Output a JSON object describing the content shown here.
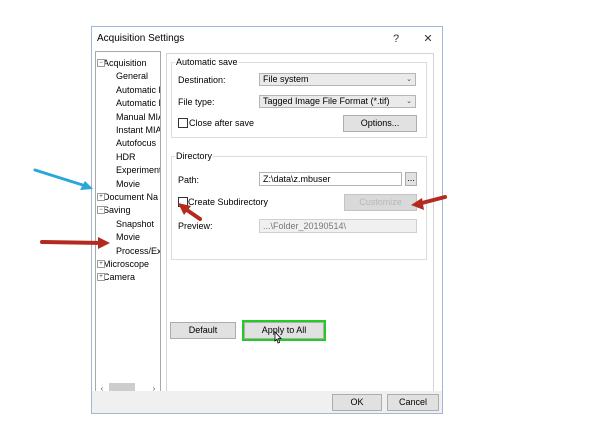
{
  "window": {
    "title": "Acquisition Settings",
    "help_glyph": "?",
    "close_glyph": "✕"
  },
  "tree": {
    "items": [
      {
        "label": "Acquisition",
        "toggle": "−"
      },
      {
        "label": "General"
      },
      {
        "label": "Automatic E"
      },
      {
        "label": "Automatic M"
      },
      {
        "label": "Manual MIA"
      },
      {
        "label": "Instant MIA"
      },
      {
        "label": "Autofocus"
      },
      {
        "label": "HDR"
      },
      {
        "label": "Experiment"
      },
      {
        "label": "Movie"
      },
      {
        "label": "Document Na",
        "toggle": "+"
      },
      {
        "label": "Saving",
        "toggle": "−"
      },
      {
        "label": "Snapshot"
      },
      {
        "label": "Movie"
      },
      {
        "label": "Process/Exp"
      },
      {
        "label": "Microscope",
        "toggle": "+"
      },
      {
        "label": "Camera",
        "toggle": "+"
      }
    ],
    "scroll_left": "‹",
    "scroll_right": "›"
  },
  "autosave": {
    "group_title": "Automatic save",
    "destination_label": "Destination:",
    "destination_value": "File system",
    "filetype_label": "File type:",
    "filetype_value": "Tagged Image File Format (*.tif)",
    "close_after_save_label": "Close after save",
    "options_label": "Options..."
  },
  "directory": {
    "group_title": "Directory",
    "path_label": "Path:",
    "path_value": "Z:\\data\\z.mbuser",
    "browse_label": "...",
    "create_subdir_label": "Create Subdirectory",
    "customize_label": "Customize",
    "preview_label": "Preview:",
    "preview_value": "...\\Folder_20190514\\"
  },
  "actions": {
    "default_label": "Default",
    "apply_all_label": "Apply to All"
  },
  "footer": {
    "ok_label": "OK",
    "cancel_label": "Cancel"
  },
  "colors": {
    "annotation_blue": "#2aa6d9",
    "annotation_red": "#b42a1e",
    "highlight_green": "#22cc22"
  }
}
